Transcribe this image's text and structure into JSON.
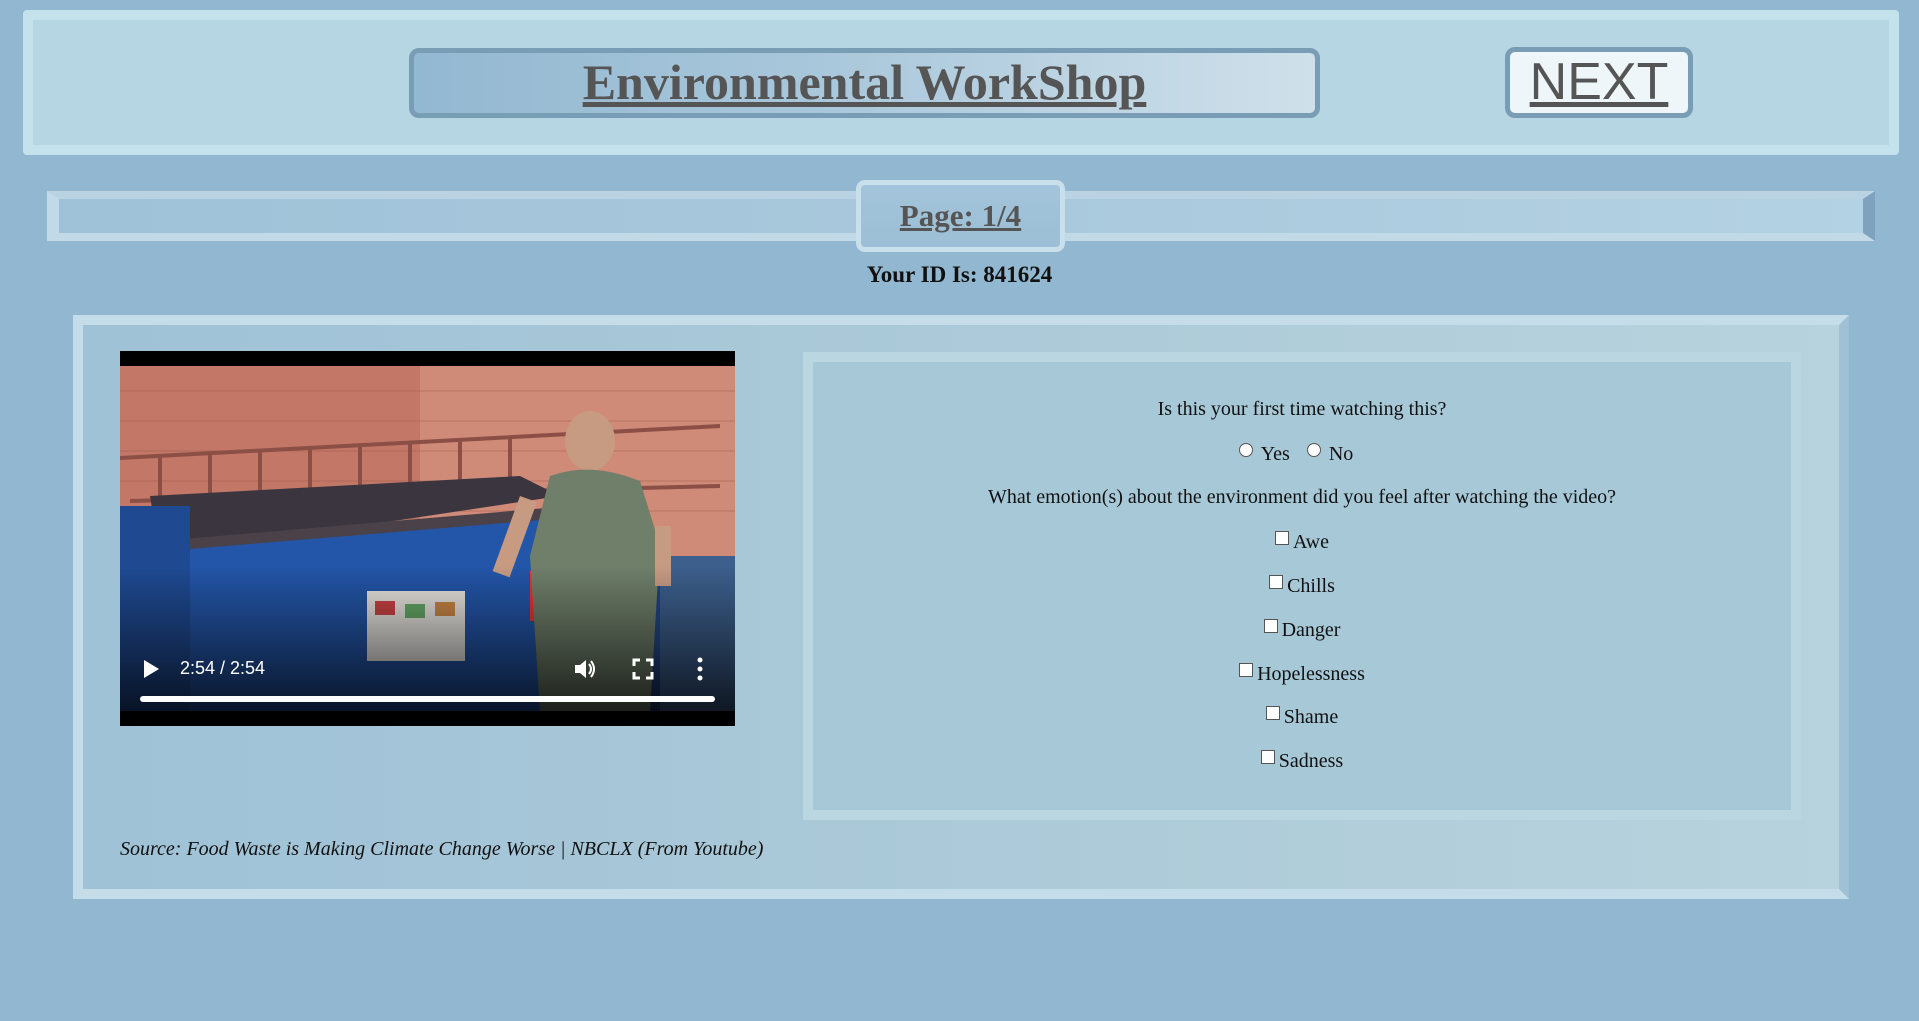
{
  "header": {
    "title": "Environmental WorkShop",
    "next_label": "NEXT"
  },
  "pagination": {
    "label": "Page: 1/4"
  },
  "user": {
    "id_label": "Your ID Is: 841624"
  },
  "video": {
    "time_display": "2:54 / 2:54",
    "progress_fraction": 1.0,
    "controls": [
      "play-icon",
      "volume-icon",
      "fullscreen-icon",
      "more-options-icon"
    ]
  },
  "source": {
    "text": "Source: Food Waste is Making Climate Change Worse | NBCLX (From Youtube)"
  },
  "quiz": {
    "question1": "Is this your first time watching this?",
    "q1_options": [
      "Yes",
      "No"
    ],
    "question2": "What emotion(s) about the environment did you feel after watching the video?",
    "q2_options": [
      "Awe",
      "Chills",
      "Danger",
      "Hopelessness",
      "Shame",
      "Sadness"
    ]
  },
  "colors": {
    "page_background": "#92b7d0",
    "header_background": "#b7d6e3",
    "title_text": "#555555",
    "border_accent": "#7a9db6"
  }
}
